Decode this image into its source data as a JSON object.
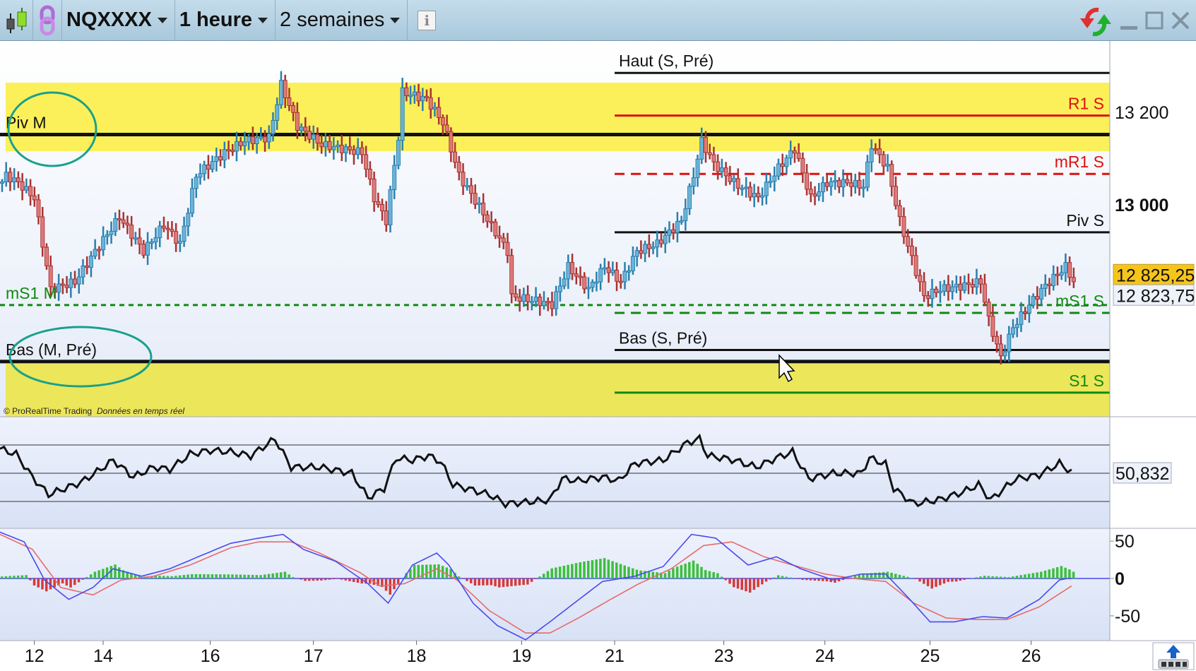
{
  "toolbar": {
    "instrument": "NQXXXX",
    "timeframe": "1 heure",
    "period": "2 semaines",
    "info_icon": "info-icon",
    "chart_type_icon": "candlestick-icon",
    "link_icon": "chain-link-icon",
    "refresh_icon": "refresh-icon"
  },
  "window_controls": {
    "minimize": "minimize-icon",
    "maximize": "maximize-icon",
    "close": "close-icon"
  },
  "copyright": "© ProRealTime Trading",
  "realtime_note": "Données en temps réel",
  "chart_data": {
    "type": "candlestick",
    "price_axis": {
      "ticks": [
        {
          "value": 13200,
          "label": "13 200",
          "bold": false
        },
        {
          "value": 13000,
          "label": "13 000",
          "bold": true
        }
      ]
    },
    "last_price": "12 825,25",
    "second_price": "12 823,75",
    "date_ticks": [
      {
        "hour": 8.5,
        "label": "12"
      },
      {
        "hour": 25.5,
        "label": "14"
      },
      {
        "hour": 52,
        "label": "16"
      },
      {
        "hour": 77.5,
        "label": "17"
      },
      {
        "hour": 103,
        "label": "18"
      },
      {
        "hour": 129,
        "label": "19"
      },
      {
        "hour": 152,
        "label": "21"
      },
      {
        "hour": 179,
        "label": "23"
      },
      {
        "hour": 204,
        "label": "24"
      },
      {
        "hour": 230,
        "label": "25"
      },
      {
        "hour": 255,
        "label": "26"
      }
    ],
    "zones": [
      {
        "from": 13264,
        "to": 13116,
        "color": "#fbf05a"
      },
      {
        "from": 12657,
        "to": 12543,
        "color": "#ece65a"
      }
    ],
    "levels": [
      {
        "name": "Haut (S, Pré)",
        "price": 13285,
        "color": "#111111",
        "style": "solid",
        "from_hour": 152,
        "label_side": "left"
      },
      {
        "name": "R1 S",
        "price": 13193,
        "color": "#e01010",
        "style": "solid",
        "from_hour": 152,
        "label_side": "right"
      },
      {
        "name": "Piv M",
        "price": 13152,
        "color": "#111111",
        "style": "solid",
        "from_hour": 0,
        "label_side": "left",
        "bold": true
      },
      {
        "name": "mR1 S",
        "price": 13067,
        "color": "#e01010",
        "style": "dash",
        "from_hour": 152,
        "label_side": "right"
      },
      {
        "name": "Piv S",
        "price": 12941,
        "color": "#111111",
        "style": "solid",
        "from_hour": 152,
        "label_side": "right"
      },
      {
        "name": "mS1 M",
        "price": 12784,
        "color": "#108a10",
        "style": "dot",
        "from_hour": 0,
        "label_side": "left"
      },
      {
        "name": "mS1 S",
        "price": 12767,
        "color": "#108a10",
        "style": "dash",
        "from_hour": 152,
        "label_side": "right"
      },
      {
        "name": "Bas (S, Pré)",
        "price": 12687,
        "color": "#111111",
        "style": "solid",
        "from_hour": 152,
        "label_side": "left"
      },
      {
        "name": "Bas (M, Pré)",
        "price": 12662,
        "color": "#111111",
        "style": "solid",
        "from_hour": 0,
        "label_side": "left",
        "bold": true
      },
      {
        "name": "S1 S",
        "price": 12595,
        "color": "#108a10",
        "style": "solid",
        "from_hour": 152,
        "label_side": "right"
      }
    ],
    "close_path": [
      [
        0,
        13050
      ],
      [
        1,
        13064
      ],
      [
        4,
        13048
      ],
      [
        8,
        13015
      ],
      [
        12,
        12818
      ],
      [
        18,
        12834
      ],
      [
        23,
        12900
      ],
      [
        29,
        12974
      ],
      [
        35,
        12900
      ],
      [
        40,
        12957
      ],
      [
        44,
        12916
      ],
      [
        48,
        13064
      ],
      [
        55,
        13113
      ],
      [
        60,
        13138
      ],
      [
        66,
        13146
      ],
      [
        69,
        13260
      ],
      [
        73,
        13170
      ],
      [
        79,
        13130
      ],
      [
        89,
        13113
      ],
      [
        92,
        13015
      ],
      [
        95,
        12966
      ],
      [
        98,
        13146
      ],
      [
        99,
        13244
      ],
      [
        105,
        13228
      ],
      [
        109,
        13178
      ],
      [
        113,
        13064
      ],
      [
        119,
        12982
      ],
      [
        125,
        12900
      ],
      [
        126,
        12802
      ],
      [
        132,
        12793
      ],
      [
        136,
        12785
      ],
      [
        140,
        12867
      ],
      [
        145,
        12818
      ],
      [
        149,
        12867
      ],
      [
        153,
        12834
      ],
      [
        157,
        12900
      ],
      [
        162,
        12916
      ],
      [
        168,
        12966
      ],
      [
        171,
        13064
      ],
      [
        173,
        13138
      ],
      [
        176,
        13089
      ],
      [
        181,
        13048
      ],
      [
        187,
        13015
      ],
      [
        192,
        13080
      ],
      [
        196,
        13121
      ],
      [
        200,
        13015
      ],
      [
        204,
        13048
      ],
      [
        209,
        13048
      ],
      [
        213,
        13040
      ],
      [
        215,
        13130
      ],
      [
        219,
        13080
      ],
      [
        222,
        12966
      ],
      [
        225,
        12884
      ],
      [
        228,
        12802
      ],
      [
        232,
        12818
      ],
      [
        238,
        12826
      ],
      [
        242,
        12834
      ],
      [
        244,
        12752
      ],
      [
        247,
        12670
      ],
      [
        250,
        12736
      ],
      [
        254,
        12785
      ],
      [
        258,
        12826
      ],
      [
        263,
        12867
      ],
      [
        265,
        12834
      ]
    ],
    "rsi": {
      "value_label": "50,832",
      "levels": [
        70,
        50,
        30
      ],
      "series": [
        [
          0,
          67.3
        ],
        [
          4,
          63.5
        ],
        [
          8,
          47.3
        ],
        [
          12,
          34.9
        ],
        [
          16,
          39.2
        ],
        [
          20,
          43.5
        ],
        [
          24,
          51.1
        ],
        [
          28,
          59.2
        ],
        [
          33,
          47.3
        ],
        [
          38,
          54.3
        ],
        [
          42,
          52.7
        ],
        [
          47,
          63.5
        ],
        [
          52,
          66.2
        ],
        [
          57,
          65.1
        ],
        [
          62,
          62.4
        ],
        [
          68,
          74.3
        ],
        [
          72,
          54.3
        ],
        [
          79,
          54.3
        ],
        [
          87,
          50
        ],
        [
          91,
          32.7
        ],
        [
          95,
          39.2
        ],
        [
          98,
          60.8
        ],
        [
          102,
          59.2
        ],
        [
          106,
          62.4
        ],
        [
          109,
          58.1
        ],
        [
          112,
          41.9
        ],
        [
          121,
          34.9
        ],
        [
          125,
          28.4
        ],
        [
          130,
          29.5
        ],
        [
          136,
          31.1
        ],
        [
          139,
          46.2
        ],
        [
          143,
          44.6
        ],
        [
          149,
          47.3
        ],
        [
          153,
          44.6
        ],
        [
          157,
          57
        ],
        [
          164,
          59.2
        ],
        [
          170,
          71.6
        ],
        [
          173,
          74.3
        ],
        [
          175,
          62.4
        ],
        [
          181,
          59.7
        ],
        [
          187,
          54.3
        ],
        [
          192,
          60.8
        ],
        [
          196,
          65.1
        ],
        [
          200,
          46.2
        ],
        [
          206,
          50
        ],
        [
          213,
          50
        ],
        [
          215,
          60.8
        ],
        [
          219,
          56.5
        ],
        [
          221,
          39.2
        ],
        [
          226,
          28.4
        ],
        [
          232,
          31.1
        ],
        [
          238,
          36.5
        ],
        [
          242,
          41.9
        ],
        [
          245,
          31.1
        ],
        [
          251,
          45.7
        ],
        [
          257,
          48.9
        ],
        [
          262,
          57
        ],
        [
          265,
          50.8
        ]
      ]
    },
    "macd": {
      "ticks": [
        {
          "value": 50,
          "label": "50",
          "bold": false
        },
        {
          "value": 0,
          "label": "0",
          "bold": true
        },
        {
          "value": -50,
          "label": "-50",
          "bold": false
        }
      ],
      "macd_line": [
        [
          0,
          62
        ],
        [
          6,
          49
        ],
        [
          11,
          -2
        ],
        [
          17,
          -28
        ],
        [
          23,
          -12
        ],
        [
          28,
          13
        ],
        [
          35,
          3
        ],
        [
          42,
          13
        ],
        [
          49,
          29
        ],
        [
          57,
          47
        ],
        [
          64,
          54
        ],
        [
          70,
          59
        ],
        [
          75,
          39
        ],
        [
          83,
          23
        ],
        [
          91,
          -7
        ],
        [
          96,
          -33
        ],
        [
          102,
          18
        ],
        [
          108,
          34
        ],
        [
          111,
          18
        ],
        [
          117,
          -33
        ],
        [
          123,
          -63
        ],
        [
          130,
          -82
        ],
        [
          136,
          -58
        ],
        [
          142,
          -33
        ],
        [
          149,
          -4
        ],
        [
          157,
          3
        ],
        [
          164,
          16
        ],
        [
          171,
          59
        ],
        [
          177,
          54
        ],
        [
          185,
          18
        ],
        [
          192,
          29
        ],
        [
          198,
          13
        ],
        [
          206,
          -2
        ],
        [
          213,
          6
        ],
        [
          219,
          6
        ],
        [
          225,
          -28
        ],
        [
          230,
          -58
        ],
        [
          236,
          -58
        ],
        [
          243,
          -51
        ],
        [
          249,
          -53
        ],
        [
          257,
          -28
        ],
        [
          262,
          -2
        ],
        [
          264,
          0
        ]
      ],
      "signal_line": [
        [
          0,
          59
        ],
        [
          8,
          39
        ],
        [
          15,
          -12
        ],
        [
          23,
          -22
        ],
        [
          30,
          -2
        ],
        [
          38,
          3
        ],
        [
          47,
          18
        ],
        [
          57,
          41
        ],
        [
          64,
          49
        ],
        [
          72,
          49
        ],
        [
          79,
          34
        ],
        [
          89,
          8
        ],
        [
          94,
          -10
        ],
        [
          100,
          -7
        ],
        [
          108,
          13
        ],
        [
          113,
          -2
        ],
        [
          121,
          -43
        ],
        [
          130,
          -73
        ],
        [
          136,
          -73
        ],
        [
          143,
          -53
        ],
        [
          151,
          -28
        ],
        [
          158,
          -7
        ],
        [
          166,
          13
        ],
        [
          174,
          44
        ],
        [
          181,
          49
        ],
        [
          189,
          29
        ],
        [
          196,
          18
        ],
        [
          204,
          6
        ],
        [
          211,
          0
        ],
        [
          219,
          -4
        ],
        [
          226,
          -33
        ],
        [
          234,
          -53
        ],
        [
          242,
          -55
        ],
        [
          249,
          -55
        ],
        [
          257,
          -38
        ],
        [
          265,
          -10
        ]
      ]
    },
    "colors": {
      "up_stroke": "#2a7fae",
      "up_fill": "#6db7dc",
      "down_stroke": "#a83232",
      "down_fill": "#e27d7d",
      "macd": "#4a4aee",
      "signal": "#e86a6a",
      "hist_up": "#3cbf3c",
      "hist_down": "#d43a3a",
      "annotation": "#19a08c"
    }
  }
}
